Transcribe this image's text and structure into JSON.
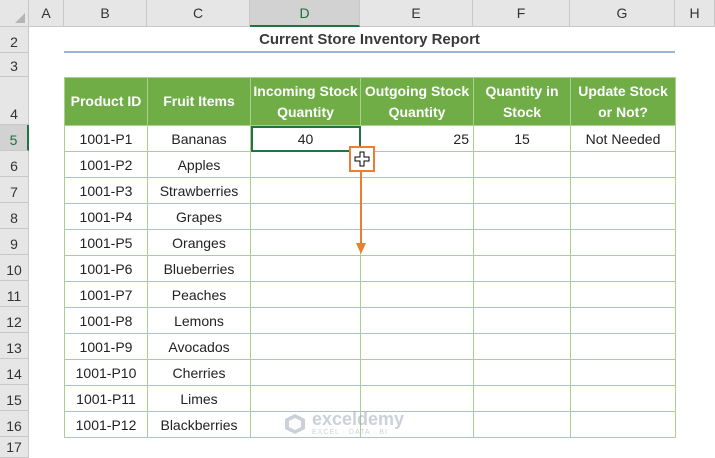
{
  "columns": [
    "A",
    "B",
    "C",
    "D",
    "E",
    "F",
    "G",
    "H"
  ],
  "selected_column": "D",
  "rows": [
    "2",
    "3",
    "4",
    "5",
    "6",
    "7",
    "8",
    "9",
    "10",
    "11",
    "12",
    "13",
    "14",
    "15",
    "16",
    "17"
  ],
  "selected_row": "5",
  "report_title": "Current Store Inventory Report",
  "headers": [
    "Product ID",
    "Fruit Items",
    "Incoming Stock Quantity",
    "Outgoing Stock Quantity",
    "Quantity in Stock",
    "Update Stock or Not?"
  ],
  "table_rows": [
    [
      "1001-P1",
      "Bananas",
      "40",
      "25",
      "15",
      "Not Needed"
    ],
    [
      "1001-P2",
      "Apples",
      "",
      "",
      "",
      ""
    ],
    [
      "1001-P3",
      "Strawberries",
      "",
      "",
      "",
      ""
    ],
    [
      "1001-P4",
      "Grapes",
      "",
      "",
      "",
      ""
    ],
    [
      "1001-P5",
      "Oranges",
      "",
      "",
      "",
      ""
    ],
    [
      "1001-P6",
      "Blueberries",
      "",
      "",
      "",
      ""
    ],
    [
      "1001-P7",
      "Peaches",
      "",
      "",
      "",
      ""
    ],
    [
      "1001-P8",
      "Lemons",
      "",
      "",
      "",
      ""
    ],
    [
      "1001-P9",
      "Avocados",
      "",
      "",
      "",
      ""
    ],
    [
      "1001-P10",
      "Cherries",
      "",
      "",
      "",
      ""
    ],
    [
      "1001-P11",
      "Limes",
      "",
      "",
      "",
      ""
    ],
    [
      "1001-P12",
      "Blackberries",
      "",
      "",
      "",
      ""
    ]
  ],
  "active_cell": "D5",
  "watermark": {
    "name": "exceldemy",
    "tagline": "EXCEL · DATA · BI"
  },
  "colors": {
    "header_green": "#70ad47",
    "border_green": "#a9d08e",
    "accent_orange": "#ed7d31",
    "excel_green": "#217346"
  }
}
